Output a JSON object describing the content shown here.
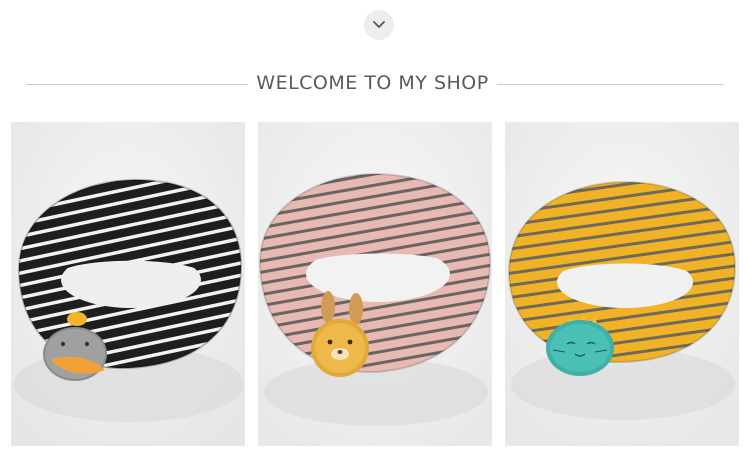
{
  "header": {
    "chevron_icon": "chevron-down-icon",
    "title": "WELCOME TO MY SHOP"
  },
  "colors": {
    "heading_text": "#5a5a5a",
    "rule": "#c9c9c9",
    "chevron_bg": "#ededed"
  },
  "products": [
    {
      "scarf_color": "black-white-stripe",
      "badge": "duck-icon"
    },
    {
      "scarf_color": "pink-grey-stripe",
      "badge": "bunny-icon"
    },
    {
      "scarf_color": "yellow-grey-stripe",
      "badge": "cat-icon"
    }
  ]
}
